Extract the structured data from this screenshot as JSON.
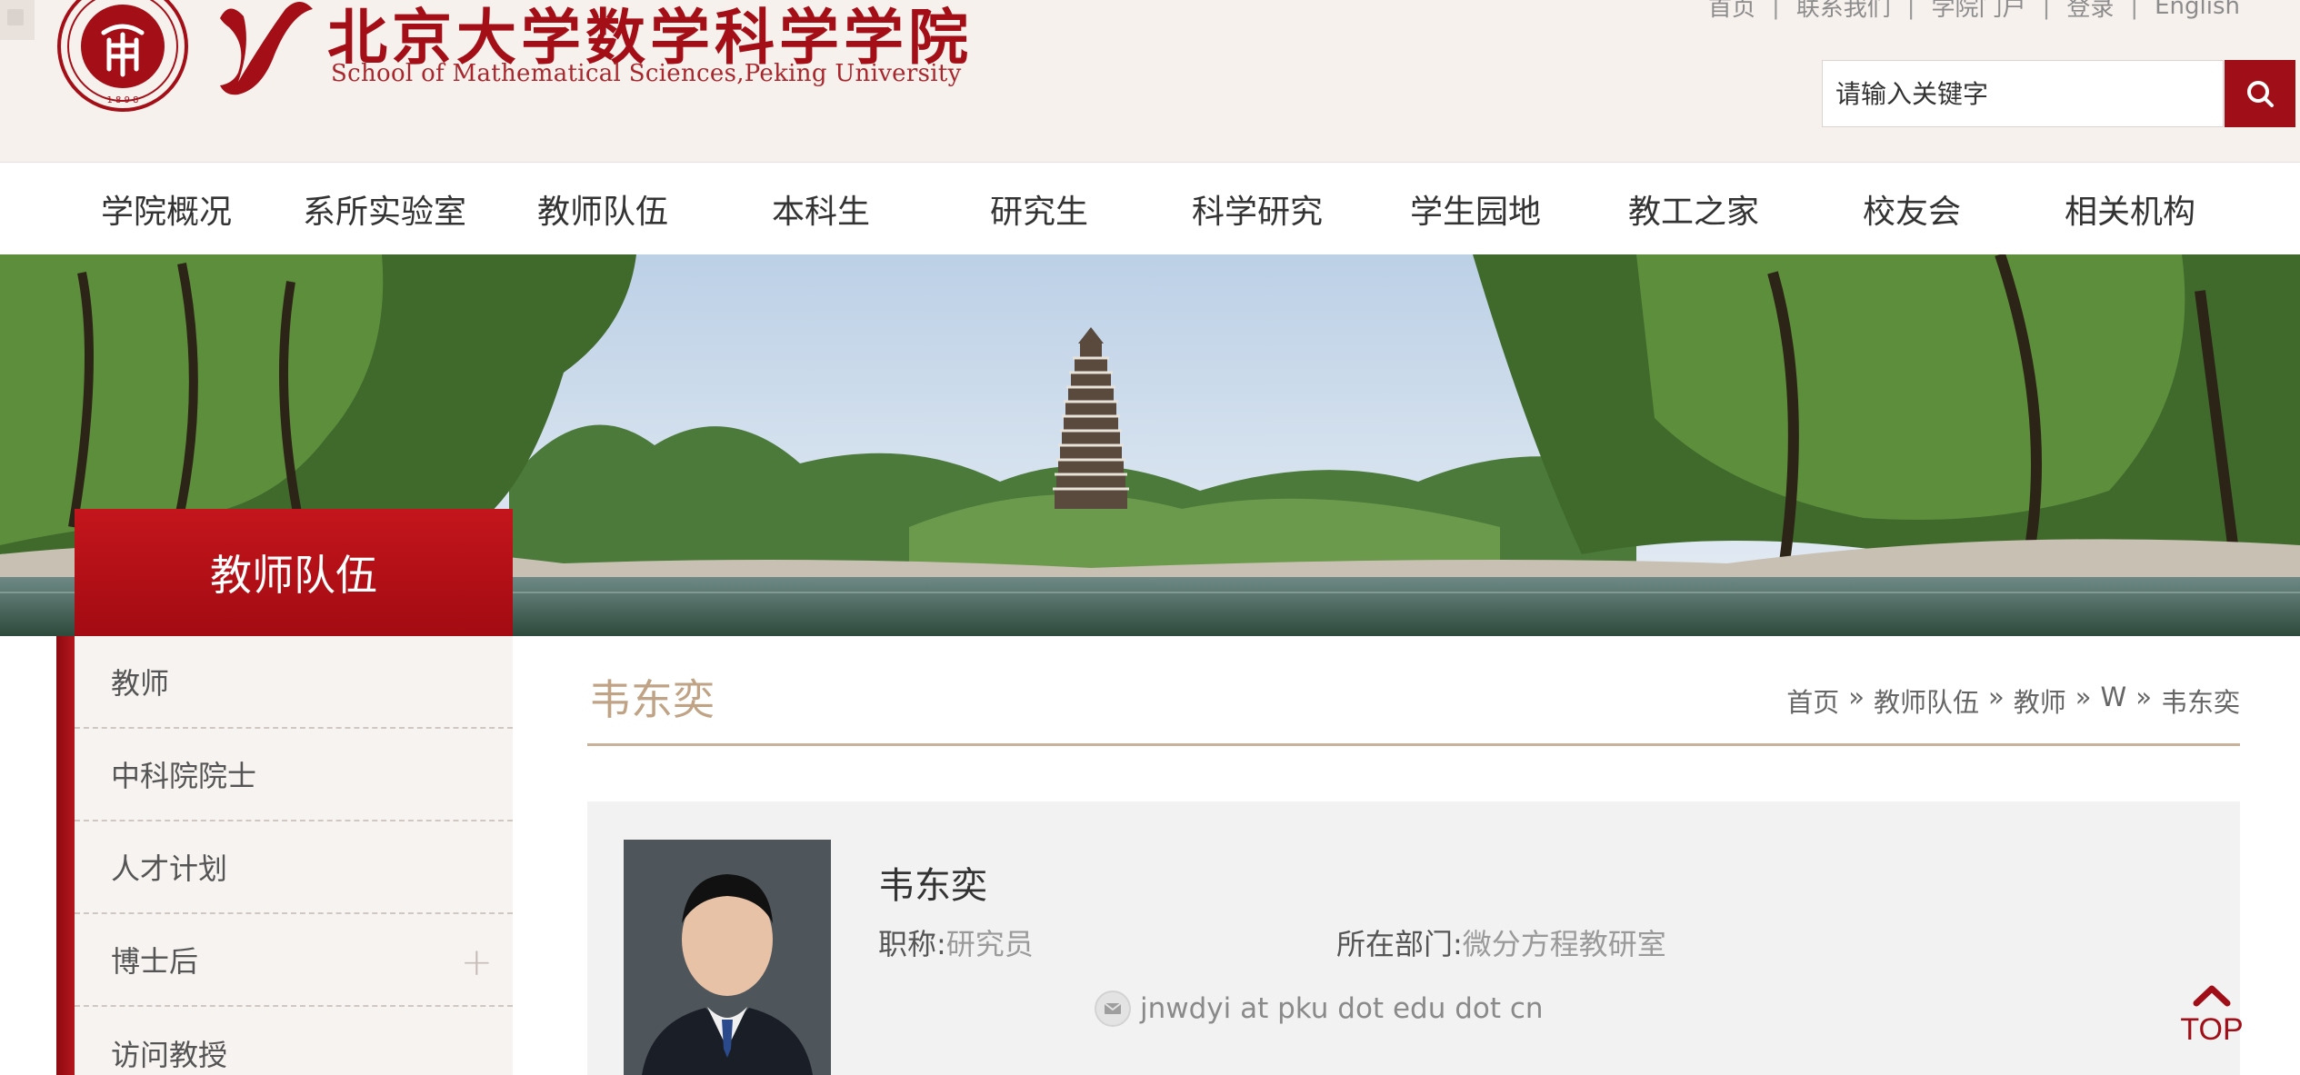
{
  "header": {
    "school_name_cn": "北京大学数学科学学院",
    "school_name_en": "School of Mathematical Sciences,Peking University",
    "seal_text": "PEKING UNIVERSITY 1898",
    "top_links": [
      "首页",
      "联系我们",
      "学院门户",
      "登录",
      "English"
    ],
    "link_separator": "|",
    "search": {
      "placeholder": "请输入关键字",
      "button_icon": "search-icon"
    },
    "colors": {
      "brand_red": "#a00f17",
      "header_bg": "#f6f1ed"
    }
  },
  "nav": {
    "items": [
      "学院概况",
      "系所实验室",
      "教师队伍",
      "本科生",
      "研究生",
      "科学研究",
      "学生园地",
      "教工之家",
      "校友会",
      "相关机构"
    ]
  },
  "sidebar": {
    "title": "教师队伍",
    "items": [
      {
        "label": "教师"
      },
      {
        "label": "中科院院士"
      },
      {
        "label": "人才计划"
      },
      {
        "label": "博士后",
        "expand_icon": "+"
      },
      {
        "label": "访问教授"
      }
    ]
  },
  "content": {
    "page_title": "韦东奕",
    "breadcrumb": [
      "首页",
      "教师队伍",
      "教师",
      "W",
      "韦东奕"
    ],
    "breadcrumb_separator": "»",
    "profile": {
      "name": "韦东奕",
      "title_label": "职称:",
      "title_value": "研究员",
      "dept_label": "所在部门:",
      "dept_value": "微分方程教研室",
      "email": "jnwdyi at pku dot edu dot cn",
      "email_icon": "mail-icon"
    }
  },
  "to_top": {
    "label": "TOP",
    "icon": "chevron-up-icon"
  }
}
